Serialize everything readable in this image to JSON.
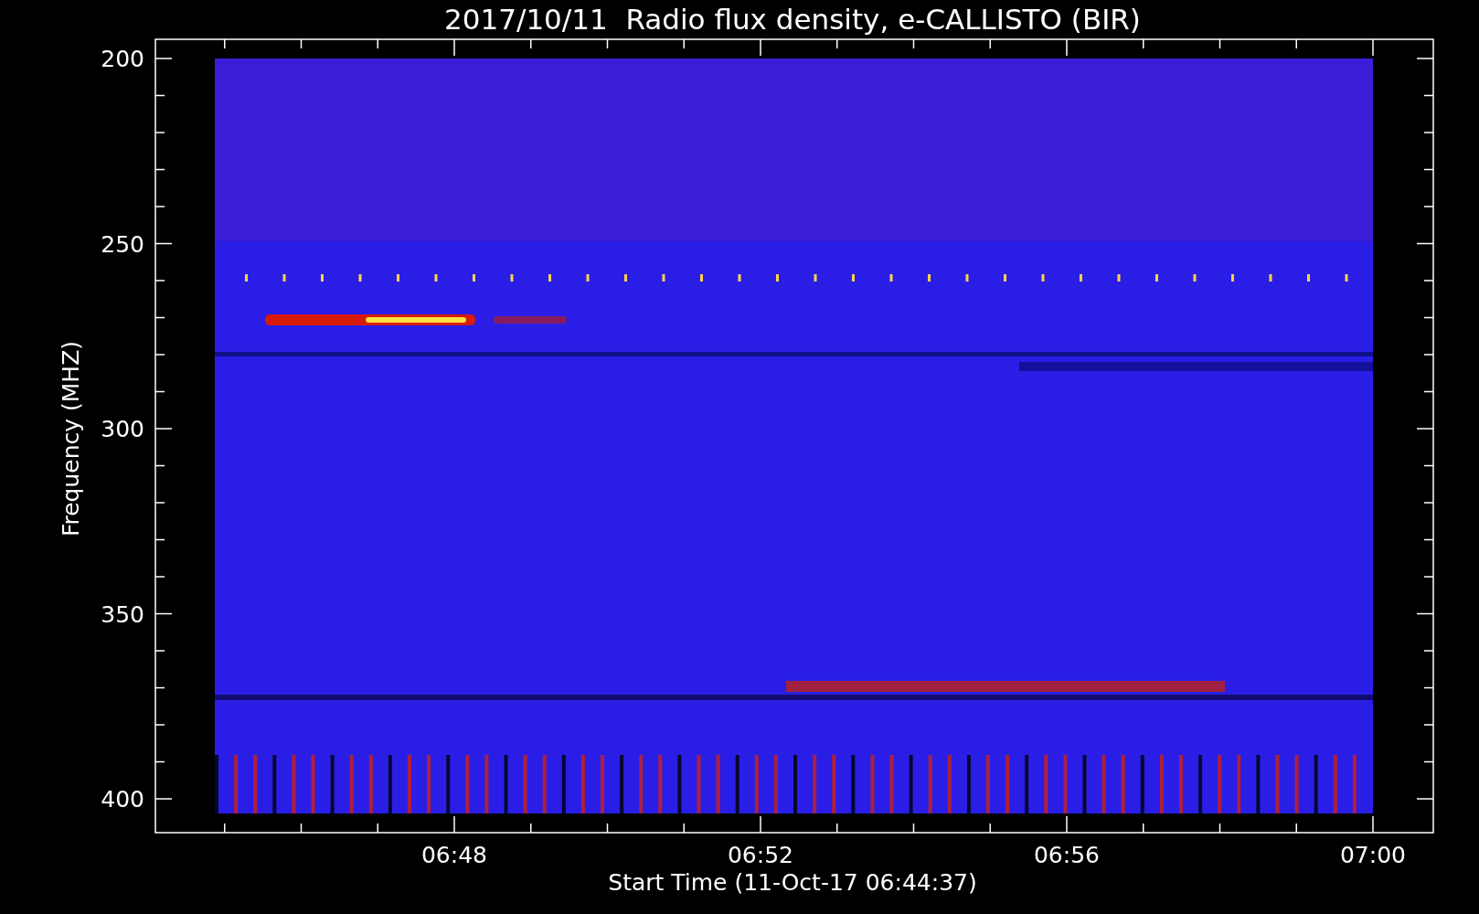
{
  "title": "2017/10/11  Radio flux density, e-CALLISTO (BIR)",
  "y_axis": {
    "label": "Frequency (MHZ)",
    "ticks": [
      "200",
      "250",
      "300",
      "350",
      "400"
    ]
  },
  "x_axis": {
    "label": "Start Time (11-Oct-17 06:44:37)",
    "ticks": [
      "06:48",
      "06:52",
      "06:56",
      "07:00"
    ]
  }
}
